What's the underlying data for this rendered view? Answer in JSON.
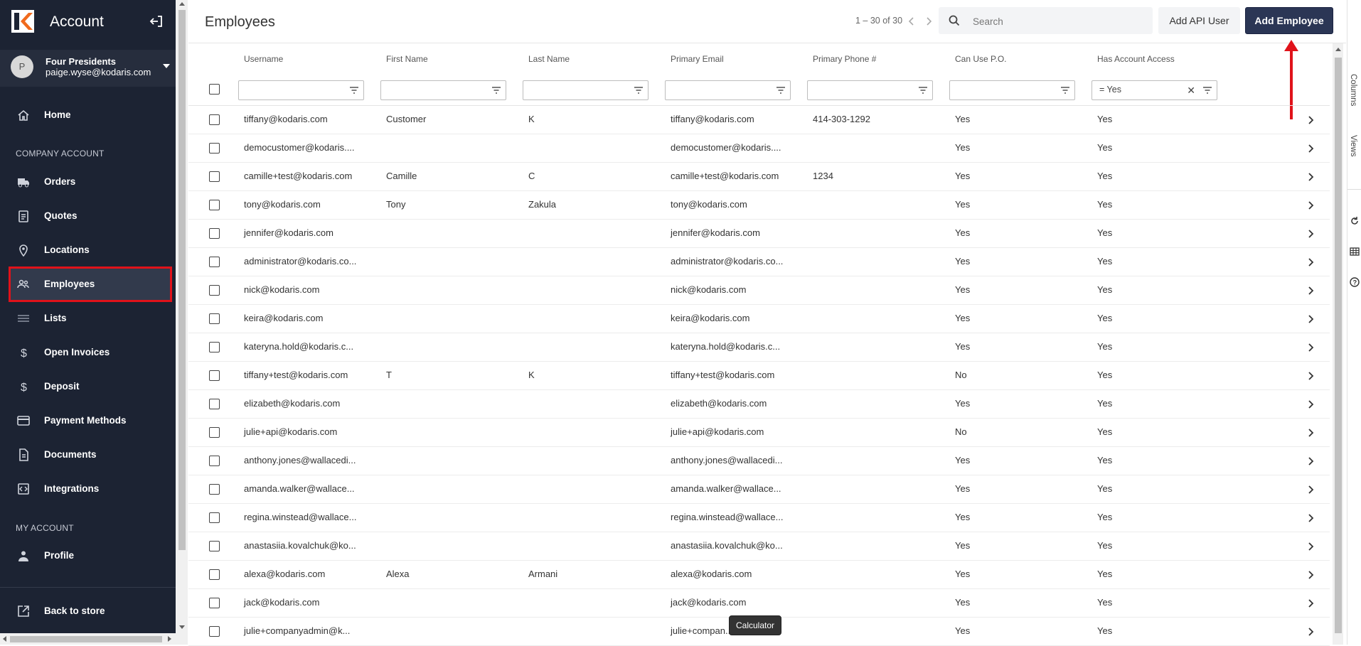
{
  "sidebar": {
    "title": "Account",
    "user": {
      "initial": "P",
      "name": "Four Presidents",
      "email": "paige.wyse@kodaris.com"
    },
    "home": "Home",
    "section_company": "COMPANY ACCOUNT",
    "company_items": [
      {
        "label": "Orders",
        "icon": "truck-icon"
      },
      {
        "label": "Quotes",
        "icon": "clipboard-icon"
      },
      {
        "label": "Locations",
        "icon": "location-pin-icon"
      },
      {
        "label": "Employees",
        "icon": "people-icon",
        "active": true
      },
      {
        "label": "Lists",
        "icon": "list-icon"
      },
      {
        "label": "Open Invoices",
        "icon": "dollar-icon"
      },
      {
        "label": "Deposit",
        "icon": "dollar-icon"
      },
      {
        "label": "Payment Methods",
        "icon": "credit-card-icon"
      },
      {
        "label": "Documents",
        "icon": "document-icon"
      },
      {
        "label": "Integrations",
        "icon": "integration-icon"
      }
    ],
    "section_my": "MY ACCOUNT",
    "my_items": [
      {
        "label": "Profile",
        "icon": "person-icon"
      }
    ],
    "back_to_store": "Back to store"
  },
  "header": {
    "title": "Employees",
    "pager": "1 – 30 of 30",
    "search_placeholder": "Search",
    "add_api_user": "Add API User",
    "add_employee": "Add Employee"
  },
  "table": {
    "columns": [
      "Username",
      "First Name",
      "Last Name",
      "Primary Email",
      "Primary Phone #",
      "Can Use P.O.",
      "Has Account Access"
    ],
    "filters": [
      "",
      "",
      "",
      "",
      "",
      "",
      "= Yes"
    ],
    "rows": [
      [
        "tiffany@kodaris.com",
        "Customer",
        "K",
        "tiffany@kodaris.com",
        "414-303-1292",
        "Yes",
        "Yes"
      ],
      [
        "democustomer@kodaris....",
        "",
        "",
        "democustomer@kodaris....",
        "",
        "Yes",
        "Yes"
      ],
      [
        "camille+test@kodaris.com",
        "Camille",
        "C",
        "camille+test@kodaris.com",
        "1234",
        "Yes",
        "Yes"
      ],
      [
        "tony@kodaris.com",
        "Tony",
        "Zakula",
        "tony@kodaris.com",
        "",
        "Yes",
        "Yes"
      ],
      [
        "jennifer@kodaris.com",
        "",
        "",
        "jennifer@kodaris.com",
        "",
        "Yes",
        "Yes"
      ],
      [
        "administrator@kodaris.co...",
        "",
        "",
        "administrator@kodaris.co...",
        "",
        "Yes",
        "Yes"
      ],
      [
        "nick@kodaris.com",
        "",
        "",
        "nick@kodaris.com",
        "",
        "Yes",
        "Yes"
      ],
      [
        "keira@kodaris.com",
        "",
        "",
        "keira@kodaris.com",
        "",
        "Yes",
        "Yes"
      ],
      [
        "kateryna.hold@kodaris.c...",
        "",
        "",
        "kateryna.hold@kodaris.c...",
        "",
        "Yes",
        "Yes"
      ],
      [
        "tiffany+test@kodaris.com",
        "T",
        "K",
        "tiffany+test@kodaris.com",
        "",
        "No",
        "Yes"
      ],
      [
        "elizabeth@kodaris.com",
        "",
        "",
        "elizabeth@kodaris.com",
        "",
        "Yes",
        "Yes"
      ],
      [
        "julie+api@kodaris.com",
        "",
        "",
        "julie+api@kodaris.com",
        "",
        "No",
        "Yes"
      ],
      [
        "anthony.jones@wallacedi...",
        "",
        "",
        "anthony.jones@wallacedi...",
        "",
        "Yes",
        "Yes"
      ],
      [
        "amanda.walker@wallace...",
        "",
        "",
        "amanda.walker@wallace...",
        "",
        "Yes",
        "Yes"
      ],
      [
        "regina.winstead@wallace...",
        "",
        "",
        "regina.winstead@wallace...",
        "",
        "Yes",
        "Yes"
      ],
      [
        "anastasiia.kovalchuk@ko...",
        "",
        "",
        "anastasiia.kovalchuk@ko...",
        "",
        "Yes",
        "Yes"
      ],
      [
        "alexa@kodaris.com",
        "Alexa",
        "Armani",
        "alexa@kodaris.com",
        "",
        "Yes",
        "Yes"
      ],
      [
        "jack@kodaris.com",
        "",
        "",
        "jack@kodaris.com",
        "",
        "Yes",
        "Yes"
      ],
      [
        "julie+companyadmin@k...",
        "",
        "",
        "julie+compan...",
        "",
        "Yes",
        "Yes"
      ]
    ]
  },
  "side_panel": {
    "columns_tab": "Columns",
    "views_tab": "Views"
  },
  "tooltip": "Calculator",
  "colors": {
    "sidebar_bg": "#1c2333",
    "accent_button": "#2b3655",
    "highlight_red": "#e0121a"
  }
}
